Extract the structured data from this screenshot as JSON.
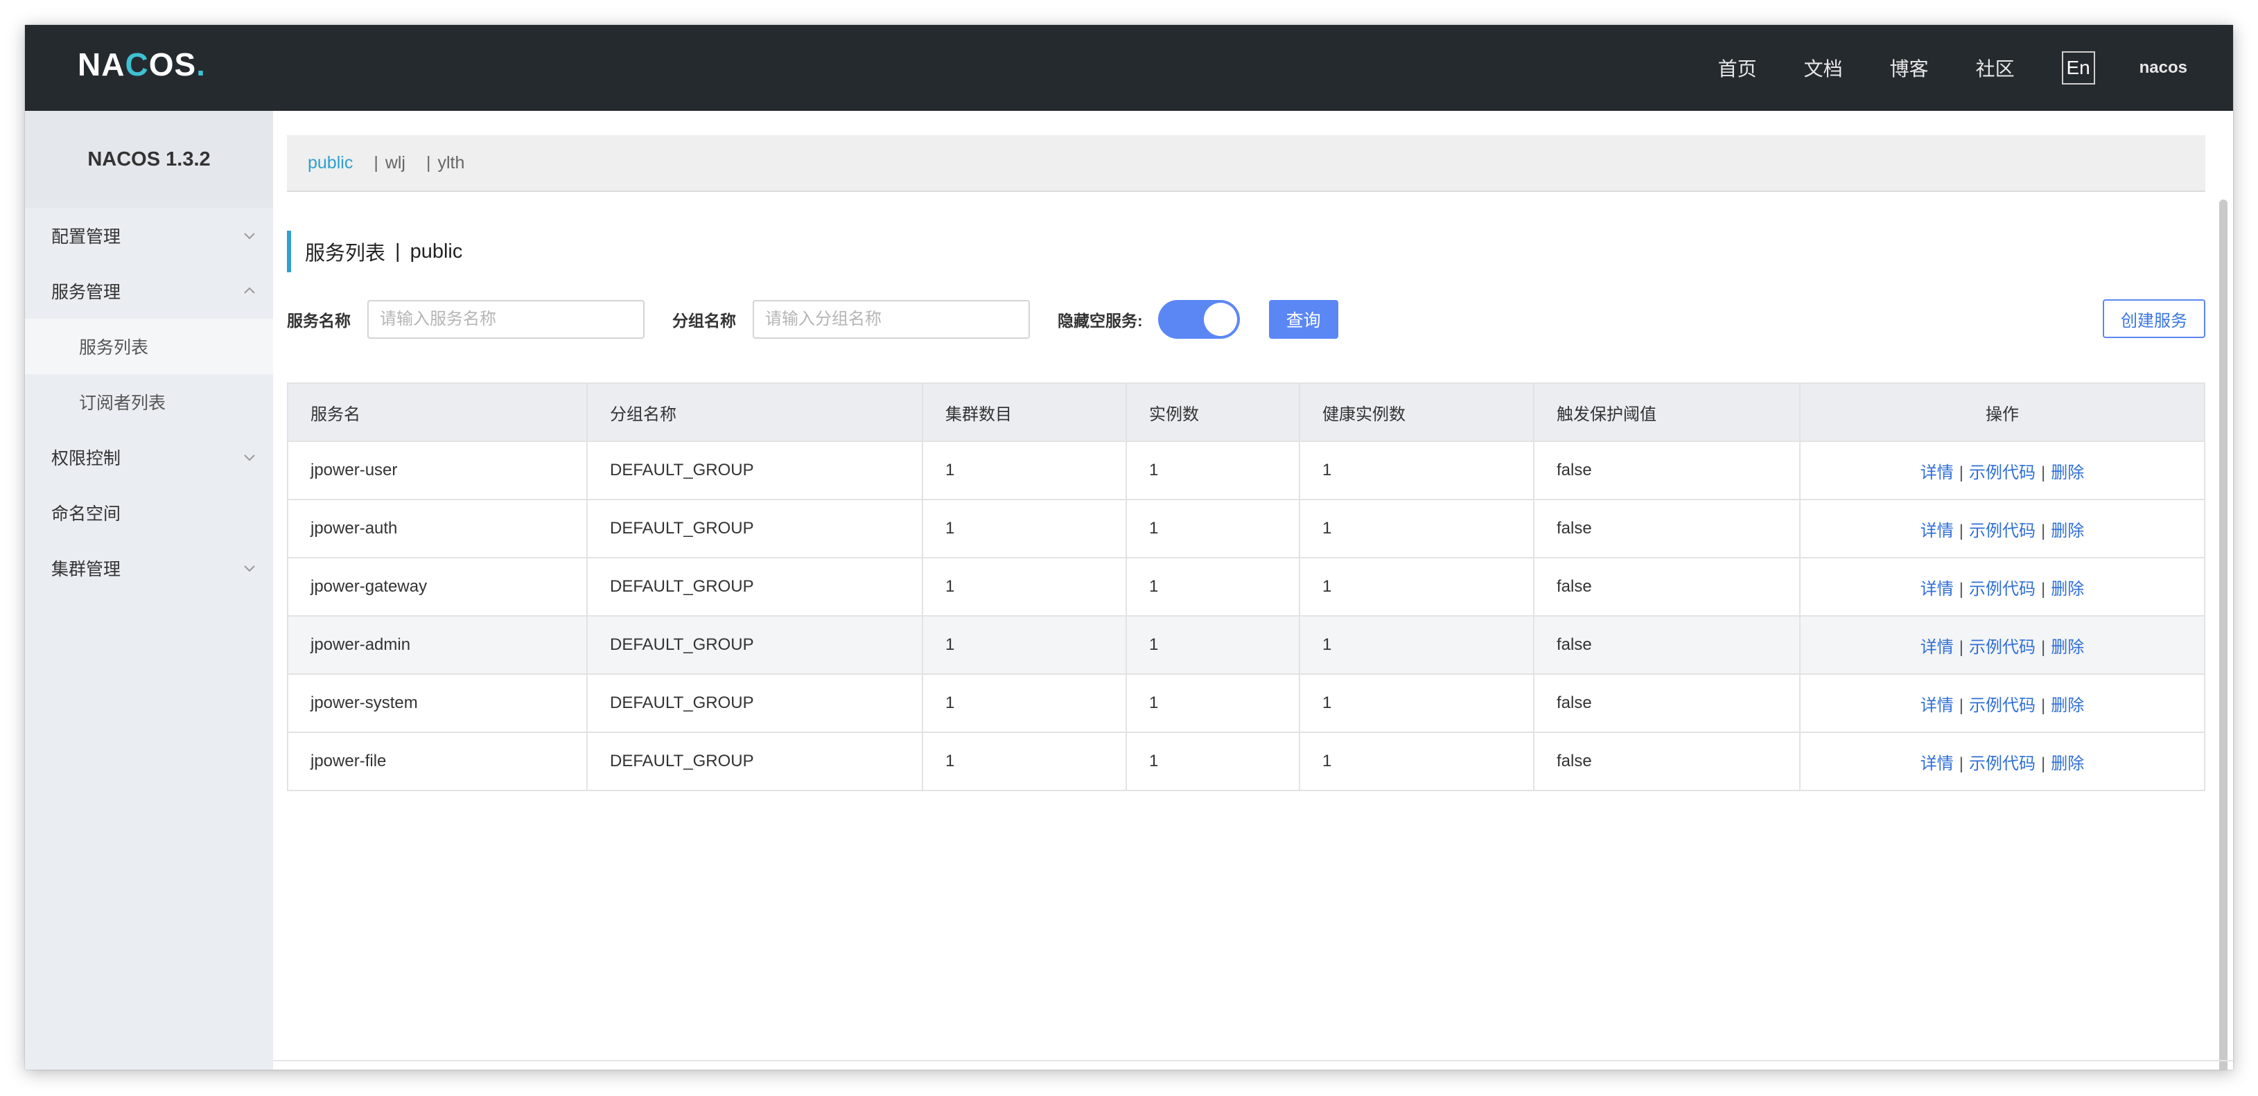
{
  "header": {
    "logo": "NACOS",
    "nav": [
      "首页",
      "文档",
      "博客",
      "社区"
    ],
    "lang": "En",
    "user": "nacos"
  },
  "sidebar": {
    "title": "NACOS 1.3.2",
    "items": [
      {
        "label": "配置管理",
        "chevron": "down"
      },
      {
        "label": "服务管理",
        "chevron": "up"
      },
      {
        "label": "服务列表",
        "sub": true,
        "active": true
      },
      {
        "label": "订阅者列表",
        "sub": true
      },
      {
        "label": "权限控制",
        "chevron": "down"
      },
      {
        "label": "命名空间"
      },
      {
        "label": "集群管理",
        "chevron": "down"
      }
    ]
  },
  "namespaces": {
    "active": "public",
    "others": [
      "wlj",
      "ylth"
    ]
  },
  "page": {
    "title": "服务列表",
    "namespace": "public"
  },
  "filters": {
    "service_name_label": "服务名称",
    "service_name_placeholder": "请输入服务名称",
    "group_name_label": "分组名称",
    "group_name_placeholder": "请输入分组名称",
    "hide_empty_label": "隐藏空服务:",
    "hide_empty_on": true,
    "query_button": "查询",
    "create_button": "创建服务"
  },
  "table": {
    "columns": [
      "服务名",
      "分组名称",
      "集群数目",
      "实例数",
      "健康实例数",
      "触发保护阈值",
      "操作"
    ],
    "actions": [
      "详情",
      "示例代码",
      "删除"
    ],
    "rows": [
      [
        "jpower-user",
        "DEFAULT_GROUP",
        "1",
        "1",
        "1",
        "false"
      ],
      [
        "jpower-auth",
        "DEFAULT_GROUP",
        "1",
        "1",
        "1",
        "false"
      ],
      [
        "jpower-gateway",
        "DEFAULT_GROUP",
        "1",
        "1",
        "1",
        "false"
      ],
      [
        "jpower-admin",
        "DEFAULT_GROUP",
        "1",
        "1",
        "1",
        "false"
      ],
      [
        "jpower-system",
        "DEFAULT_GROUP",
        "1",
        "1",
        "1",
        "false"
      ],
      [
        "jpower-file",
        "DEFAULT_GROUP",
        "1",
        "1",
        "1",
        "false"
      ]
    ]
  },
  "colors": {
    "header_bg": "#252a2f",
    "accent": "#5b87f5",
    "link": "#2f6fd6",
    "namespace_active": "#2ea1d0"
  }
}
